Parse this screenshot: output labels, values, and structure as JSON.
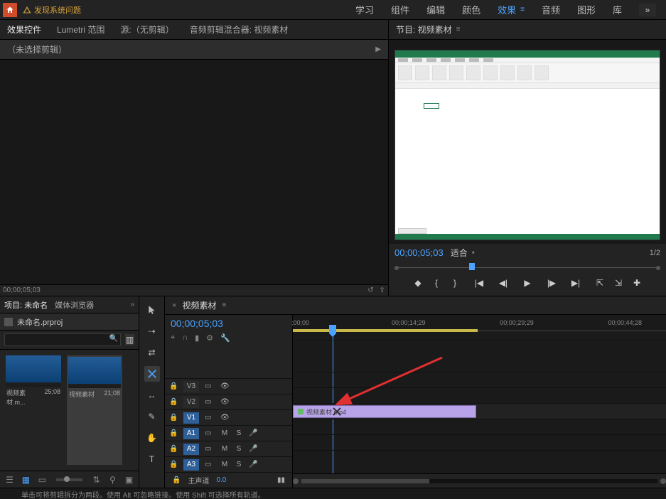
{
  "titlebar": {
    "warning_text": "发现系统问题"
  },
  "topnav": {
    "items": [
      "学习",
      "组件",
      "编辑",
      "颜色",
      "效果",
      "音频",
      "图形",
      "库"
    ],
    "active_index": 4
  },
  "source_panel": {
    "tabs": [
      "效果控件",
      "Lumetri 范围",
      "源:（无剪辑）",
      "音频剪辑混合器: 视频素材"
    ],
    "subheader": "（未选择剪辑）",
    "timecode": "00;00;05;03"
  },
  "program_panel": {
    "title": "节目: 视频素材",
    "timecode": "00;00;05;03",
    "fit_label": "适合",
    "zoom": "1/2"
  },
  "project_panel": {
    "tabs": [
      "项目: 未命名",
      "媒体浏览器"
    ],
    "proj_file": "未命名.prproj",
    "search_placeholder": "",
    "bins": [
      {
        "name": "视频素材.m...",
        "dur": "25;08"
      },
      {
        "name": "视频素材",
        "dur": "21;08"
      }
    ]
  },
  "timeline": {
    "seq_name": "视频素材",
    "timecode": "00;00;05;03",
    "ruler": [
      {
        "label": ";00;00",
        "pct": 2
      },
      {
        "label": "00;00;14;29",
        "pct": 31
      },
      {
        "label": "00;00;29;29",
        "pct": 60
      },
      {
        "label": "00;00;44;28",
        "pct": 89
      }
    ],
    "tracks_v": [
      "V3",
      "V2",
      "V1"
    ],
    "tracks_a": [
      "A1",
      "A2",
      "A3"
    ],
    "master_label": "主声道",
    "master_val": "0.0",
    "clip_label": "视频素材.mp4",
    "playhead_pct": 10.6
  },
  "statusbar": {
    "text": "单击可将剪辑拆分为两段。使用 Alt 可忽略链接。使用 Shift 可选择所有轨道。"
  }
}
